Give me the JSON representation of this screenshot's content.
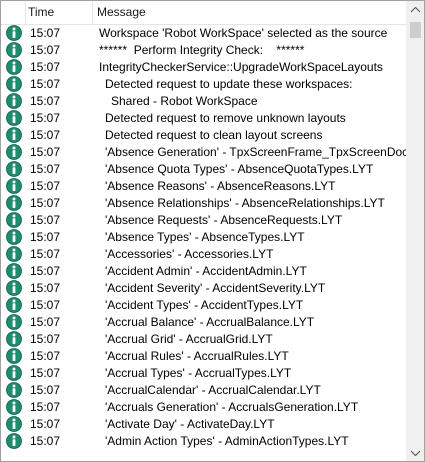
{
  "columns": {
    "time": "Time",
    "message": "Message"
  },
  "icon": "info-icon",
  "colors": {
    "icon_fill": "#1f8c6e",
    "icon_text": "#ffffff",
    "border": "#a0a0a0"
  },
  "rows": [
    {
      "time": "15:07",
      "message": "Workspace 'Robot WorkSpace' selected as the source",
      "indent": 0
    },
    {
      "time": "15:07",
      "message": "******  Perform Integrity Check:    ******",
      "indent": 0
    },
    {
      "time": "15:07",
      "message": "IntegrityCheckerService::UpgradeWorkSpaceLayouts",
      "indent": 0
    },
    {
      "time": "15:07",
      "message": "Detected request to update these workspaces:",
      "indent": 1
    },
    {
      "time": "15:07",
      "message": "Shared - Robot WorkSpace",
      "indent": 2
    },
    {
      "time": "15:07",
      "message": "Detected request to remove unknown layouts",
      "indent": 1
    },
    {
      "time": "15:07",
      "message": "Detected request to clean layout screens",
      "indent": 1
    },
    {
      "time": "15:07",
      "message": "'Absence Generation' - TpxScreenFrame_TpxScreenDocumentFrame.LYT",
      "indent": 1
    },
    {
      "time": "15:07",
      "message": "'Absence Quota Types' - AbsenceQuotaTypes.LYT",
      "indent": 1
    },
    {
      "time": "15:07",
      "message": "'Absence Reasons' - AbsenceReasons.LYT",
      "indent": 1
    },
    {
      "time": "15:07",
      "message": "'Absence Relationships' - AbsenceRelationships.LYT",
      "indent": 1
    },
    {
      "time": "15:07",
      "message": "'Absence Requests' - AbsenceRequests.LYT",
      "indent": 1
    },
    {
      "time": "15:07",
      "message": "'Absence Types' - AbsenceTypes.LYT",
      "indent": 1
    },
    {
      "time": "15:07",
      "message": "'Accessories' - Accessories.LYT",
      "indent": 1
    },
    {
      "time": "15:07",
      "message": "'Accident Admin' - AccidentAdmin.LYT",
      "indent": 1
    },
    {
      "time": "15:07",
      "message": "'Accident Severity' - AccidentSeverity.LYT",
      "indent": 1
    },
    {
      "time": "15:07",
      "message": "'Accident Types' - AccidentTypes.LYT",
      "indent": 1
    },
    {
      "time": "15:07",
      "message": "'Accrual Balance' - AccrualBalance.LYT",
      "indent": 1
    },
    {
      "time": "15:07",
      "message": "'Accrual Grid' - AccrualGrid.LYT",
      "indent": 1
    },
    {
      "time": "15:07",
      "message": "'Accrual Rules' - AccrualRules.LYT",
      "indent": 1
    },
    {
      "time": "15:07",
      "message": "'Accrual Types' - AccrualTypes.LYT",
      "indent": 1
    },
    {
      "time": "15:07",
      "message": "'AccrualCalendar' - AccrualCalendar.LYT",
      "indent": 1
    },
    {
      "time": "15:07",
      "message": "'Accruals Generation' - AccrualsGeneration.LYT",
      "indent": 1
    },
    {
      "time": "15:07",
      "message": "'Activate Day' - ActivateDay.LYT",
      "indent": 1
    },
    {
      "time": "15:07",
      "message": "'Admin Action Types' - AdminActionTypes.LYT",
      "indent": 1
    }
  ]
}
